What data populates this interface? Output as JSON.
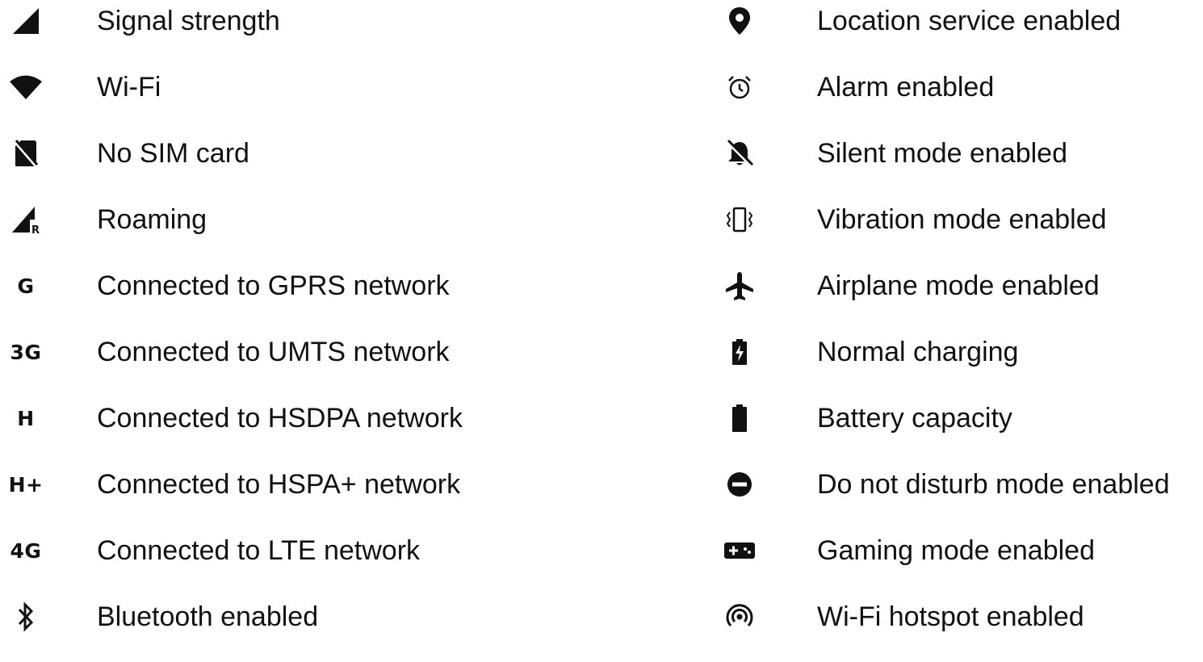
{
  "left_items": [
    {
      "icon": "signal-strength-icon",
      "label": "Signal strength"
    },
    {
      "icon": "wifi-icon",
      "label": "Wi-Fi"
    },
    {
      "icon": "no-sim-icon",
      "label": "No SIM card"
    },
    {
      "icon": "roaming-icon",
      "label": "Roaming"
    },
    {
      "icon": "gprs-icon",
      "icon_text": "G",
      "label": "Connected to GPRS network"
    },
    {
      "icon": "umts-icon",
      "icon_text": "3G",
      "label": "Connected to UMTS network"
    },
    {
      "icon": "hsdpa-icon",
      "icon_text": "H",
      "label": "Connected to HSDPA network"
    },
    {
      "icon": "hspa-plus-icon",
      "icon_text": "H+",
      "label": "Connected to HSPA+ network"
    },
    {
      "icon": "lte-icon",
      "icon_text": "4G",
      "label": "Connected to LTE network"
    },
    {
      "icon": "bluetooth-icon",
      "label": "Bluetooth enabled"
    }
  ],
  "right_items": [
    {
      "icon": "location-icon",
      "label": "Location service enabled"
    },
    {
      "icon": "alarm-icon",
      "label": "Alarm enabled"
    },
    {
      "icon": "silent-bell-icon",
      "label": "Silent mode enabled"
    },
    {
      "icon": "vibration-icon",
      "label": "Vibration mode enabled"
    },
    {
      "icon": "airplane-icon",
      "label": "Airplane mode enabled"
    },
    {
      "icon": "battery-charging-icon",
      "label": "Normal charging"
    },
    {
      "icon": "battery-icon",
      "label": "Battery capacity"
    },
    {
      "icon": "do-not-disturb-icon",
      "label": "Do not disturb mode enabled"
    },
    {
      "icon": "gamepad-icon",
      "label": "Gaming mode enabled"
    },
    {
      "icon": "hotspot-icon",
      "label": "Wi-Fi hotspot enabled"
    }
  ],
  "colors": {
    "text": "#111111",
    "icon": "#111111",
    "background": "#ffffff"
  }
}
